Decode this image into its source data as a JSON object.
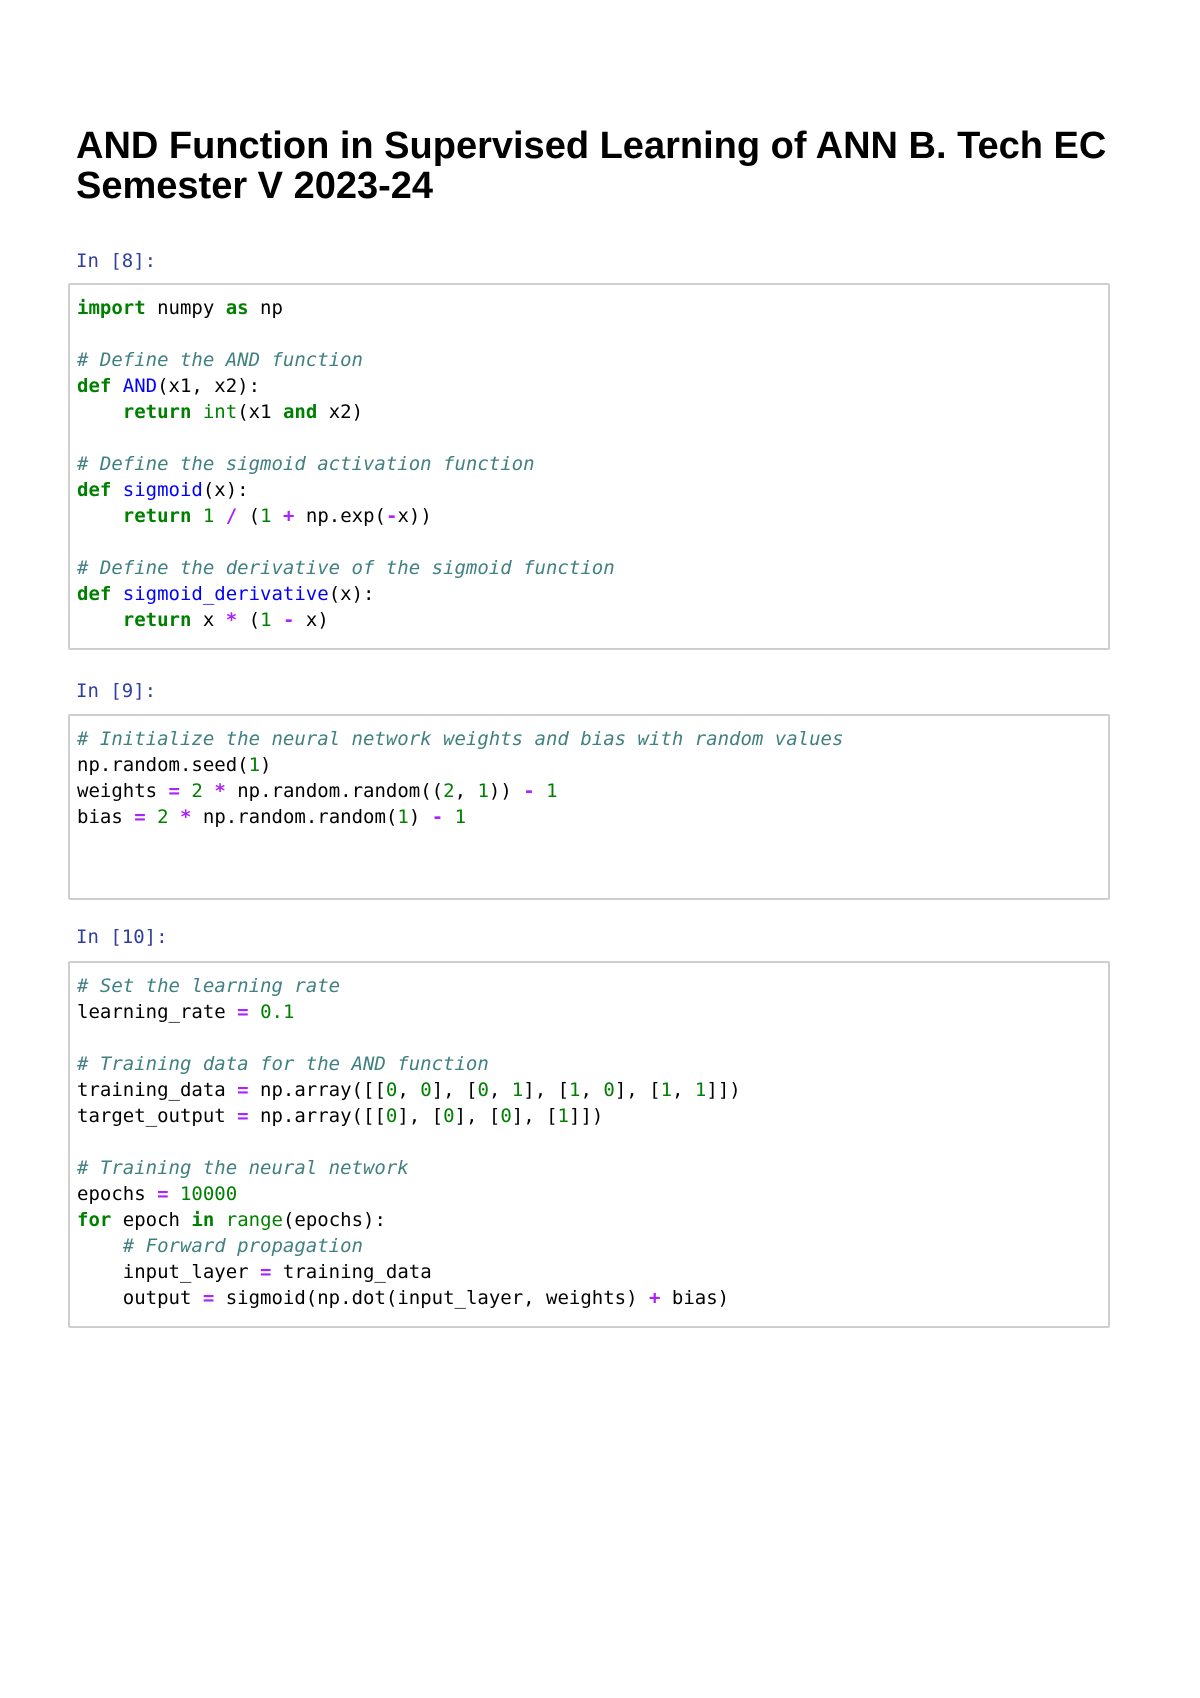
{
  "title": "AND Function in Supervised Learning of ANN B. Tech EC Semester V 2023-24",
  "cells": [
    {
      "prompt": "In [8]:",
      "lines": [
        [
          [
            "kw",
            "import"
          ],
          [
            "t",
            " numpy "
          ],
          [
            "kw",
            "as"
          ],
          [
            "t",
            " np"
          ]
        ],
        [],
        [
          [
            "cm",
            "# Define the AND function"
          ]
        ],
        [
          [
            "kw",
            "def"
          ],
          [
            "t",
            " "
          ],
          [
            "fn",
            "AND"
          ],
          [
            "t",
            "(x1, x2):"
          ]
        ],
        [
          [
            "t",
            "    "
          ],
          [
            "kw",
            "return"
          ],
          [
            "t",
            " "
          ],
          [
            "bi",
            "int"
          ],
          [
            "t",
            "(x1 "
          ],
          [
            "kw",
            "and"
          ],
          [
            "t",
            " x2)"
          ]
        ],
        [],
        [
          [
            "cm",
            "# Define the sigmoid activation function"
          ]
        ],
        [
          [
            "kw",
            "def"
          ],
          [
            "t",
            " "
          ],
          [
            "fn",
            "sigmoid"
          ],
          [
            "t",
            "(x):"
          ]
        ],
        [
          [
            "t",
            "    "
          ],
          [
            "kw",
            "return"
          ],
          [
            "t",
            " "
          ],
          [
            "nm",
            "1"
          ],
          [
            "t",
            " "
          ],
          [
            "op",
            "/"
          ],
          [
            "t",
            " ("
          ],
          [
            "nm",
            "1"
          ],
          [
            "t",
            " "
          ],
          [
            "op",
            "+"
          ],
          [
            "t",
            " np.exp("
          ],
          [
            "op",
            "-"
          ],
          [
            "t",
            "x))"
          ]
        ],
        [],
        [
          [
            "cm",
            "# Define the derivative of the sigmoid function"
          ]
        ],
        [
          [
            "kw",
            "def"
          ],
          [
            "t",
            " "
          ],
          [
            "fn",
            "sigmoid_derivative"
          ],
          [
            "t",
            "(x):"
          ]
        ],
        [
          [
            "t",
            "    "
          ],
          [
            "kw",
            "return"
          ],
          [
            "t",
            " x "
          ],
          [
            "op",
            "*"
          ],
          [
            "t",
            " ("
          ],
          [
            "nm",
            "1"
          ],
          [
            "t",
            " "
          ],
          [
            "op",
            "-"
          ],
          [
            "t",
            " x)"
          ]
        ]
      ]
    },
    {
      "prompt": "In [9]:",
      "lines": [
        [
          [
            "cm",
            "# Initialize the neural network weights and bias with random values"
          ]
        ],
        [
          [
            "t",
            "np.random.seed("
          ],
          [
            "nm",
            "1"
          ],
          [
            "t",
            ")"
          ]
        ],
        [
          [
            "t",
            "weights "
          ],
          [
            "op",
            "="
          ],
          [
            "t",
            " "
          ],
          [
            "nm",
            "2"
          ],
          [
            "t",
            " "
          ],
          [
            "op",
            "*"
          ],
          [
            "t",
            " np.random.random(("
          ],
          [
            "nm",
            "2"
          ],
          [
            "t",
            ", "
          ],
          [
            "nm",
            "1"
          ],
          [
            "t",
            ")) "
          ],
          [
            "op",
            "-"
          ],
          [
            "t",
            " "
          ],
          [
            "nm",
            "1"
          ]
        ],
        [
          [
            "t",
            "bias "
          ],
          [
            "op",
            "="
          ],
          [
            "t",
            " "
          ],
          [
            "nm",
            "2"
          ],
          [
            "t",
            " "
          ],
          [
            "op",
            "*"
          ],
          [
            "t",
            " np.random.random("
          ],
          [
            "nm",
            "1"
          ],
          [
            "t",
            ") "
          ],
          [
            "op",
            "-"
          ],
          [
            "t",
            " "
          ],
          [
            "nm",
            "1"
          ]
        ]
      ]
    },
    {
      "prompt": "In [10]:",
      "lines": [
        [
          [
            "cm",
            "# Set the learning rate"
          ]
        ],
        [
          [
            "t",
            "learning_rate "
          ],
          [
            "op",
            "="
          ],
          [
            "t",
            " "
          ],
          [
            "nm",
            "0.1"
          ]
        ],
        [],
        [
          [
            "cm",
            "# Training data for the AND function"
          ]
        ],
        [
          [
            "t",
            "training_data "
          ],
          [
            "op",
            "="
          ],
          [
            "t",
            " np.array([["
          ],
          [
            "nm",
            "0"
          ],
          [
            "t",
            ", "
          ],
          [
            "nm",
            "0"
          ],
          [
            "t",
            "], ["
          ],
          [
            "nm",
            "0"
          ],
          [
            "t",
            ", "
          ],
          [
            "nm",
            "1"
          ],
          [
            "t",
            "], ["
          ],
          [
            "nm",
            "1"
          ],
          [
            "t",
            ", "
          ],
          [
            "nm",
            "0"
          ],
          [
            "t",
            "], ["
          ],
          [
            "nm",
            "1"
          ],
          [
            "t",
            ", "
          ],
          [
            "nm",
            "1"
          ],
          [
            "t",
            "]])"
          ]
        ],
        [
          [
            "t",
            "target_output "
          ],
          [
            "op",
            "="
          ],
          [
            "t",
            " np.array([["
          ],
          [
            "nm",
            "0"
          ],
          [
            "t",
            "], ["
          ],
          [
            "nm",
            "0"
          ],
          [
            "t",
            "], ["
          ],
          [
            "nm",
            "0"
          ],
          [
            "t",
            "], ["
          ],
          [
            "nm",
            "1"
          ],
          [
            "t",
            "]])"
          ]
        ],
        [],
        [
          [
            "cm",
            "# Training the neural network"
          ]
        ],
        [
          [
            "t",
            "epochs "
          ],
          [
            "op",
            "="
          ],
          [
            "t",
            " "
          ],
          [
            "nm",
            "10000"
          ]
        ],
        [
          [
            "kw",
            "for"
          ],
          [
            "t",
            " epoch "
          ],
          [
            "kw",
            "in"
          ],
          [
            "t",
            " "
          ],
          [
            "bi",
            "range"
          ],
          [
            "t",
            "(epochs):"
          ]
        ],
        [
          [
            "t",
            "    "
          ],
          [
            "cm",
            "# Forward propagation"
          ]
        ],
        [
          [
            "t",
            "    input_layer "
          ],
          [
            "op",
            "="
          ],
          [
            "t",
            " training_data"
          ]
        ],
        [
          [
            "t",
            "    output "
          ],
          [
            "op",
            "="
          ],
          [
            "t",
            " sigmoid(np.dot(input_layer, weights) "
          ],
          [
            "op",
            "+"
          ],
          [
            "t",
            " bias)"
          ]
        ]
      ]
    }
  ]
}
